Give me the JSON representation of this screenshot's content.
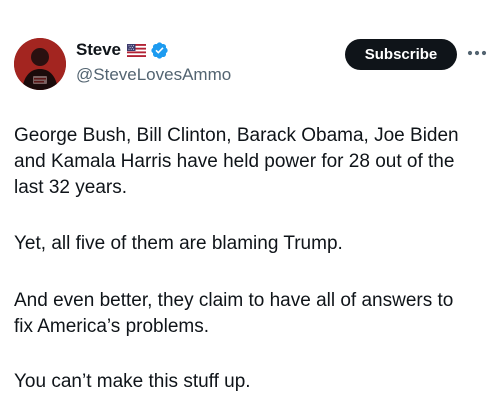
{
  "author": {
    "display_name": "Steve",
    "handle": "@SteveLovesAmmo",
    "flag_icon": "us-flag-icon",
    "verified_icon": "verified-badge-icon",
    "verified_color": "#1d9bf0"
  },
  "actions": {
    "subscribe_label": "Subscribe",
    "more_icon": "more-dots-icon"
  },
  "post": {
    "paragraphs": [
      "George Bush, Bill Clinton, Barack Obama, Joe Biden\nand Kamala Harris have held power for 28 out of the\nlast 32 years.",
      "Yet, all five of them are blaming Trump.",
      "And even better, they claim to have all of answers to\nfix America’s problems.",
      "You can’t make this stuff up."
    ]
  }
}
